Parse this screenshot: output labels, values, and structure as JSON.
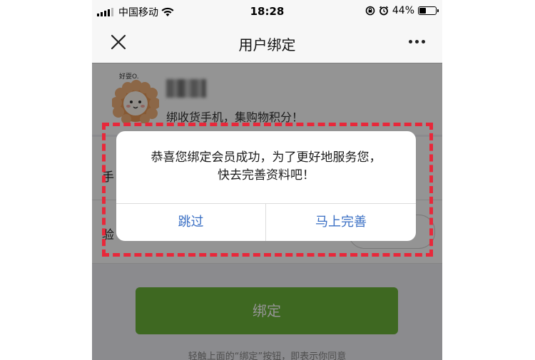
{
  "status_bar": {
    "carrier": "中国移动",
    "time": "18:28",
    "battery": "44%",
    "battery_level": 0.44
  },
  "navbar": {
    "title": "用户绑定"
  },
  "profile": {
    "avatar_text": "好耍O.",
    "subtitle": "绑收货手机，集购物积分！"
  },
  "form": {
    "phone_label": "手",
    "code_label": "验"
  },
  "bind_button": "绑定",
  "terms": "轻触上面的“绑定”按钮，即表示你同意",
  "dialog": {
    "message_line1": "恭喜您绑定会员成功，为了更好地服务您，",
    "message_line2": "快去完善资料吧！",
    "skip_button": "跳过",
    "complete_button": "马上完善"
  },
  "colors": {
    "highlight_dash": "#e8283a",
    "dialog_button_text": "#3a6fc4",
    "bind_button_bg": "#6bb33a"
  }
}
